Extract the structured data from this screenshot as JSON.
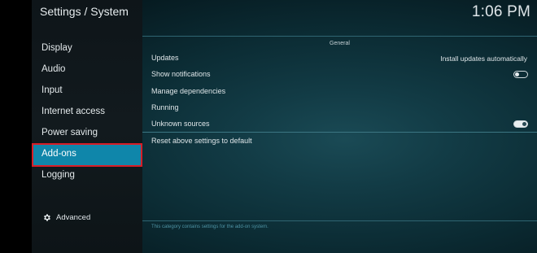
{
  "header": {
    "title": "Settings / System",
    "clock": "1:06 PM"
  },
  "sidebar": {
    "items": [
      {
        "label": "Display"
      },
      {
        "label": "Audio"
      },
      {
        "label": "Input"
      },
      {
        "label": "Internet access"
      },
      {
        "label": "Power saving"
      },
      {
        "label": "Add-ons",
        "selected": true
      },
      {
        "label": "Logging"
      }
    ],
    "advanced": {
      "label": "Advanced",
      "icon": "gear-icon"
    },
    "highlight_color": "#0f86aa",
    "annotation_border_color": "#d81d27"
  },
  "content": {
    "section_header": "General",
    "settings": [
      {
        "label": "Updates",
        "value": "Install updates automatically"
      },
      {
        "label": "Show notifications",
        "toggle": "off"
      },
      {
        "label": "Manage dependencies"
      },
      {
        "label": "Running"
      },
      {
        "label": "Unknown sources",
        "toggle": "on"
      },
      {
        "label": "Reset above settings to default"
      }
    ],
    "footer": "This category contains settings for the add-on system."
  }
}
